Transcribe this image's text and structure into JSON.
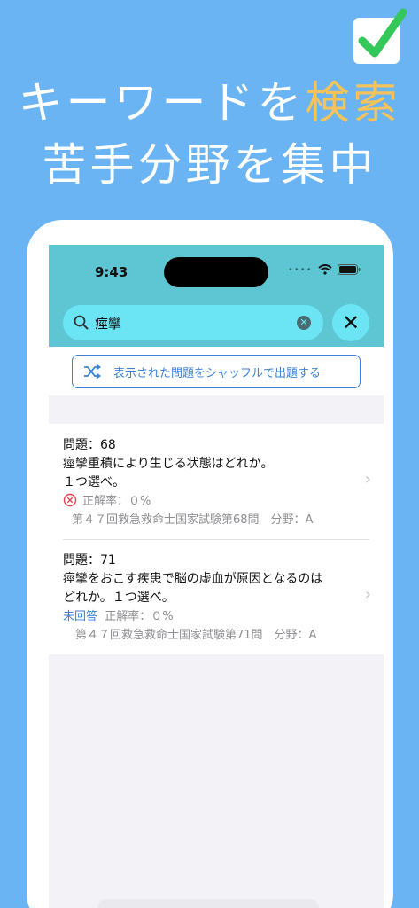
{
  "promo": {
    "headline_part1": "キーワードを",
    "headline_highlight": "検索",
    "headline_line2": "苦手分野を集中"
  },
  "status_bar": {
    "time": "9:43"
  },
  "search": {
    "query": "痙攣"
  },
  "shuffle_button": {
    "label": "表示された問題をシャッフルで出題する"
  },
  "results": [
    {
      "number": "問題：68",
      "text_line1": "痙攣重積により生じる状態はどれか。",
      "text_line2": "１つ選べ。",
      "status": "incorrect",
      "accuracy": "正解率：０%",
      "source": "第４７回救急救命士国家試験第68問　分野：A"
    },
    {
      "number": "問題：71",
      "text_line1": "痙攣をおこす疾患で脳の虚血が原因となるのは",
      "text_line2": "どれか。１つ選べ。",
      "status_label": "未回答",
      "accuracy": "正解率：０%",
      "source": "第４７回救急救命士国家試験第71問　分野：A"
    }
  ],
  "colors": {
    "background": "#6ab4f3",
    "highlight": "#f6c35a",
    "header": "#5ec6d2",
    "search_bg": "#6be4f4",
    "accent_blue": "#3b82d6",
    "error_red": "#e0444f",
    "check_green": "#34c759"
  }
}
